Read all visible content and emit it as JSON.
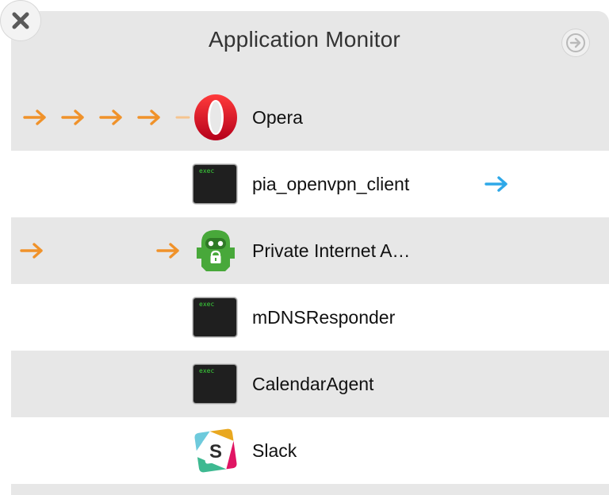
{
  "window": {
    "title": "Application Monitor"
  },
  "colors": {
    "orange_arrow": "#f0922a",
    "blue_arrow": "#2ea8e8"
  },
  "apps": [
    {
      "name": "Opera",
      "icon": "opera-icon"
    },
    {
      "name": "pia_openvpn_client",
      "icon": "terminal-exec-icon",
      "exec_label": "exec"
    },
    {
      "name": "Private Internet A…",
      "icon": "pia-robot-icon"
    },
    {
      "name": "mDNSResponder",
      "icon": "terminal-exec-icon",
      "exec_label": "exec"
    },
    {
      "name": "CalendarAgent",
      "icon": "terminal-exec-icon",
      "exec_label": "exec"
    },
    {
      "name": "Slack",
      "icon": "slack-icon"
    }
  ]
}
